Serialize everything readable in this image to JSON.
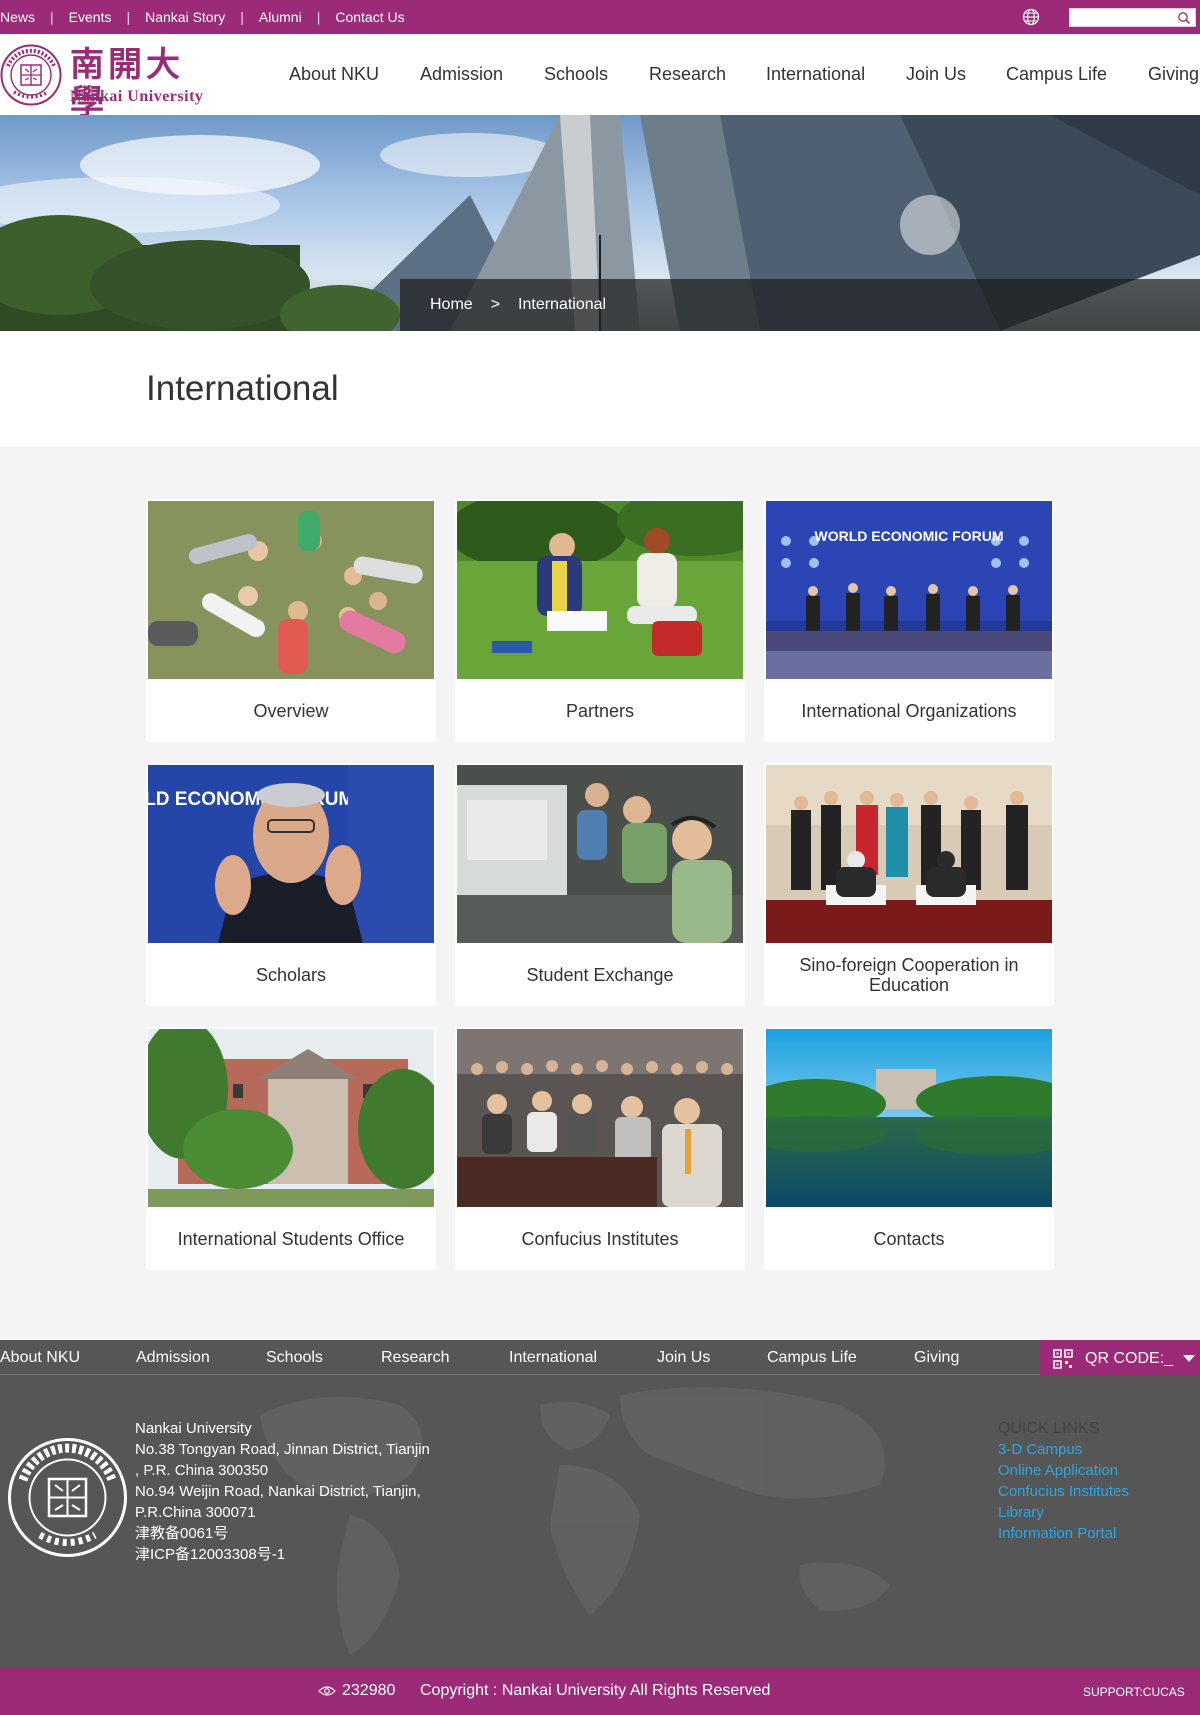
{
  "topbar": {
    "links": [
      "News",
      "Events",
      "Nankai Story",
      "Alumni",
      "Contact Us"
    ],
    "search_placeholder": ""
  },
  "logo": {
    "name_cn": "南開大學",
    "name_en": "Nankai University",
    "seal_text": "NANKAI UNIVERSITY",
    "seal_year": "1919"
  },
  "nav": [
    "About NKU",
    "Admission",
    "Schools",
    "Research",
    "International",
    "Join Us",
    "Campus Life",
    "Giving"
  ],
  "breadcrumb": {
    "home": "Home",
    "separator": ">",
    "current": "International"
  },
  "page_title": "International",
  "cards": [
    {
      "label": "Overview"
    },
    {
      "label": "Partners"
    },
    {
      "label": "International Organizations",
      "banner_text": "WORLD ECONOMIC FORUM"
    },
    {
      "label": "Scholars",
      "banner_text": "WORLD ECONOMIC FORUM"
    },
    {
      "label": "Student Exchange"
    },
    {
      "label": "Sino-foreign Cooperation in Education"
    },
    {
      "label": "International Students Office"
    },
    {
      "label": "Confucius Institutes"
    },
    {
      "label": "Contacts"
    }
  ],
  "footer_nav": [
    "About NKU",
    "Admission",
    "Schools",
    "Research",
    "International",
    "Join Us",
    "Campus Life",
    "Giving"
  ],
  "qr": {
    "label": "QR CODE:_"
  },
  "address": [
    "Nankai University",
    "No.38 Tongyan Road, Jinnan District, Tianjin",
    ", P.R. China 300350",
    "No.94 Weijin Road,  Nankai District, Tianjin,",
    "P.R.China  300071",
    "津教备0061号",
    "津ICP备12003308号-1"
  ],
  "quick_links": {
    "heading": "QUICK LINKS",
    "items": [
      "3-D Campus",
      "Online Application",
      "Confucius Institutes",
      "Library",
      "Information Portal"
    ]
  },
  "bottom": {
    "visits": "232980",
    "copyright": "Copyright : Nankai University All Rights Reserved",
    "support": "SUPPORT:CUCAS"
  },
  "colors": {
    "brand": "#9b2a79",
    "footer": "#565656",
    "link": "#2aa6e6"
  }
}
